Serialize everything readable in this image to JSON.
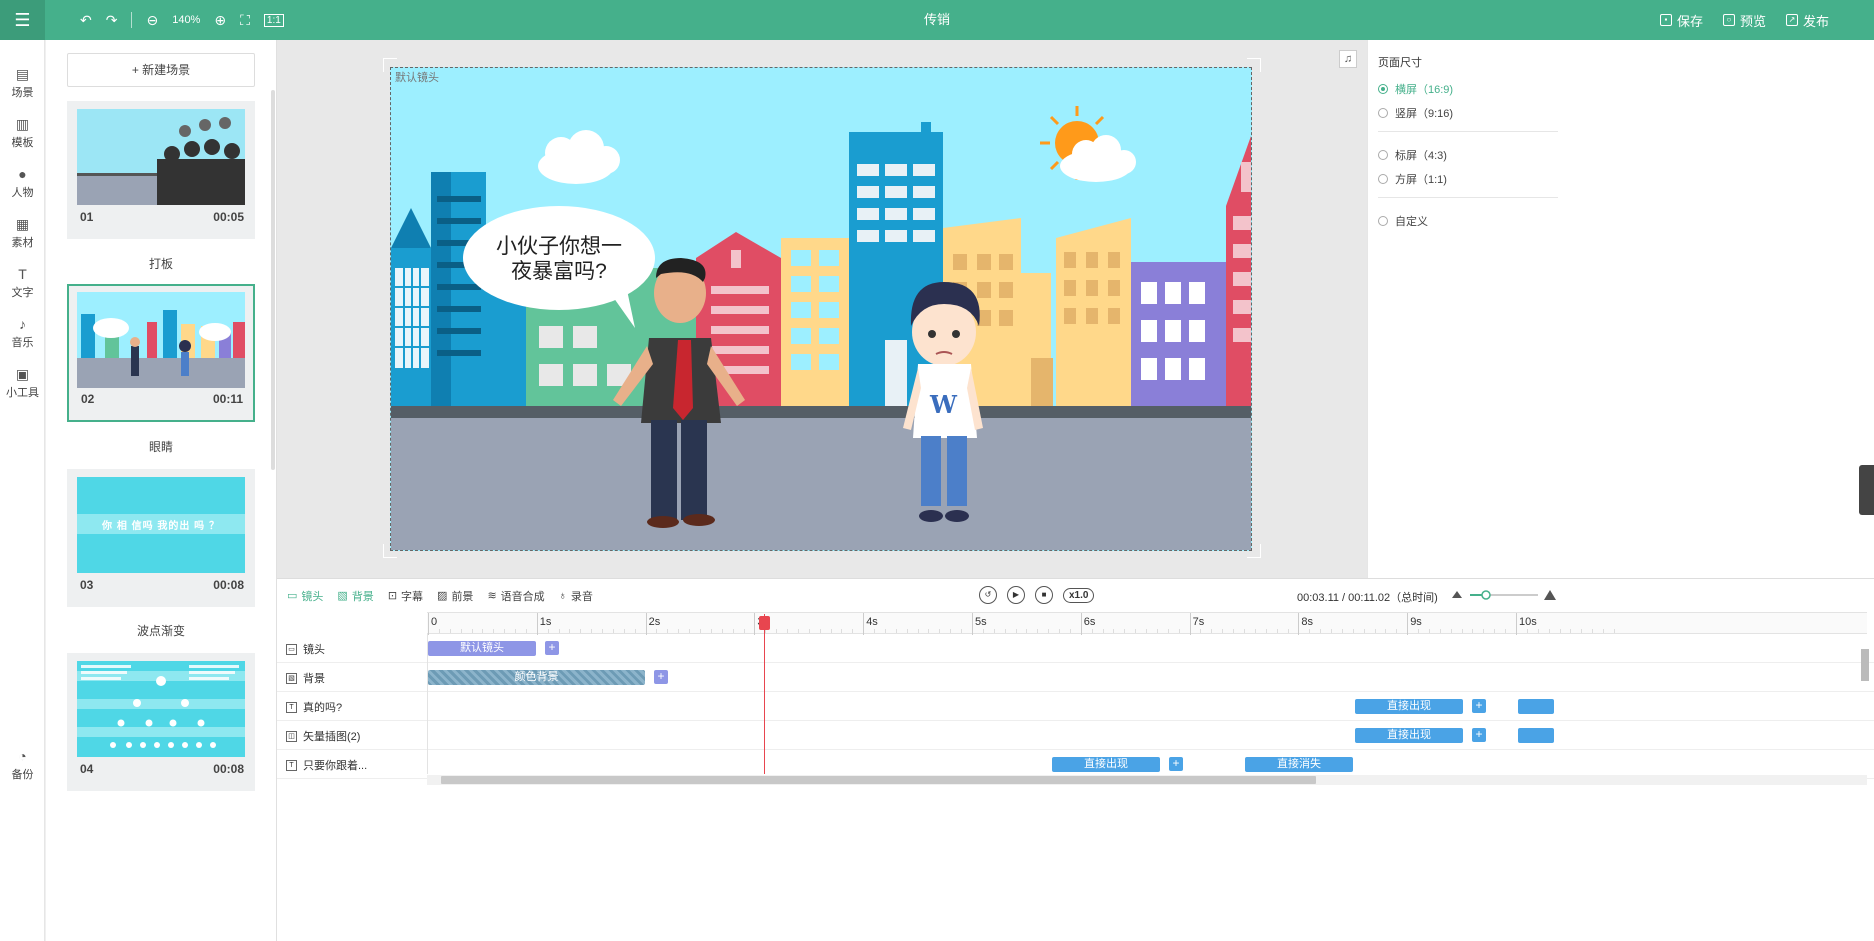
{
  "header": {
    "zoom": "140%",
    "title": "传销",
    "save": "保存",
    "preview": "预览",
    "publish": "发布"
  },
  "iconbar": [
    {
      "label": "场景",
      "icon": "scene-icon"
    },
    {
      "label": "模板",
      "icon": "template-icon"
    },
    {
      "label": "人物",
      "icon": "person-icon"
    },
    {
      "label": "素材",
      "icon": "material-icon"
    },
    {
      "label": "文字",
      "icon": "text-icon"
    },
    {
      "label": "音乐",
      "icon": "music-icon"
    },
    {
      "label": "小工具",
      "icon": "toolbox-icon"
    },
    {
      "label": "备份",
      "icon": "backup-icon"
    }
  ],
  "scenes": {
    "new_label": "+ 新建场景",
    "items": [
      {
        "num": "01",
        "dur": "00:05",
        "name": "打板"
      },
      {
        "num": "02",
        "dur": "00:11",
        "name": "眼睛"
      },
      {
        "num": "03",
        "dur": "00:08",
        "name": "波点渐变"
      },
      {
        "num": "04",
        "dur": "00:08",
        "name": ""
      }
    ],
    "thumb3_text": "你 相 信吗 我的出 吗 ？"
  },
  "stage": {
    "label": "默认镜头",
    "bubble_line1": "小伙子你想一",
    "bubble_line2": "夜暴富吗?",
    "shirt_letter": "W"
  },
  "settings": {
    "title": "页面尺寸",
    "options": [
      "横屏（16:9)",
      "竖屏（9:16)",
      "标屏（4:3)",
      "方屏（1:1)",
      "自定义"
    ]
  },
  "timeline": {
    "tabs": [
      "镜头",
      "背景",
      "字幕",
      "前景",
      "语音合成",
      "录音"
    ],
    "speed": "x1.0",
    "time": "00:03.11 / 00:11.02（总时间)",
    "ticks": [
      "0",
      "1s",
      "2s",
      "3s",
      "4s",
      "5s",
      "6s",
      "7s",
      "8s",
      "9s",
      "10s"
    ],
    "tracks": [
      {
        "name": "镜头"
      },
      {
        "name": "背景"
      },
      {
        "name": "真的吗?"
      },
      {
        "name": "矢量插图(2)"
      },
      {
        "name": "只要你跟着..."
      }
    ],
    "clips": {
      "camera": "默认镜头",
      "bg": "颜色背景",
      "appear1": "直接出现",
      "appear2": "直接出现",
      "appear3": "直接出现",
      "disappear": "直接消失"
    }
  }
}
